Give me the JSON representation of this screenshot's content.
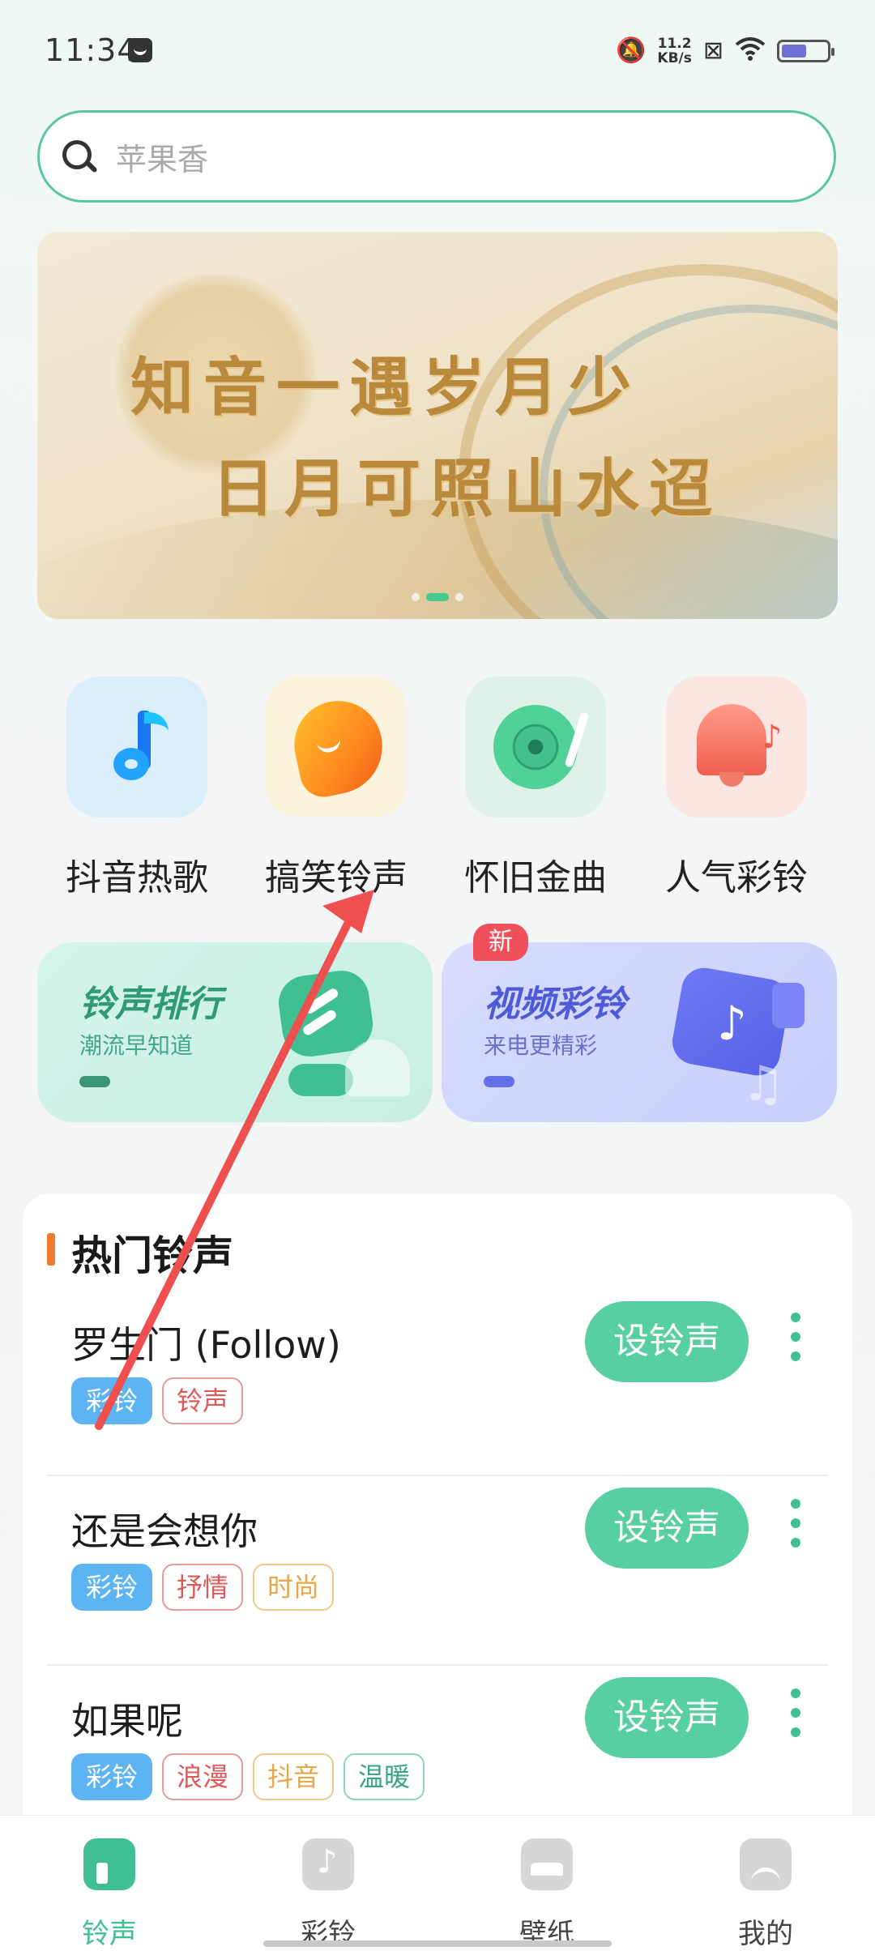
{
  "status_bar": {
    "time": "11:34",
    "net_speed_value": "11.2",
    "net_speed_unit": "KB/s",
    "icons": [
      "message-icon",
      "mute-icon",
      "data-saver-icon",
      "wifi-icon",
      "battery-icon"
    ]
  },
  "search": {
    "placeholder": "苹果香"
  },
  "banner": {
    "line1": "知音一遇岁月少",
    "line2": "日月可照山水迢",
    "page_count": 3,
    "active_page": 2
  },
  "categories": [
    {
      "label": "抖音热歌",
      "icon": "tiktok-note-icon"
    },
    {
      "label": "搞笑铃声",
      "icon": "funny-phone-icon"
    },
    {
      "label": "怀旧金曲",
      "icon": "vinyl-disc-icon"
    },
    {
      "label": "人气彩铃",
      "icon": "bell-icon"
    }
  ],
  "promos": {
    "ranking": {
      "title": "铃声排行",
      "subtitle": "潮流早知道"
    },
    "video": {
      "title": "视频彩铃",
      "subtitle": "来电更精彩",
      "badge": "新"
    }
  },
  "hot_section": {
    "title": "热门铃声",
    "set_label": "设铃声",
    "songs": [
      {
        "name": "罗生门 (Follow)",
        "tags": [
          "彩铃",
          "铃声"
        ]
      },
      {
        "name": "还是会想你",
        "tags": [
          "彩铃",
          "抒情",
          "时尚"
        ]
      },
      {
        "name": "如果呢",
        "tags": [
          "彩铃",
          "浪漫",
          "抖音",
          "温暖"
        ]
      }
    ]
  },
  "tabbar": {
    "tabs": [
      {
        "label": "铃声",
        "active": true
      },
      {
        "label": "彩铃",
        "active": false
      },
      {
        "label": "壁纸",
        "active": false
      },
      {
        "label": "我的",
        "active": false
      }
    ]
  },
  "colors": {
    "accent": "#3fbf92",
    "annotation_arrow": "#ee4f4f"
  }
}
